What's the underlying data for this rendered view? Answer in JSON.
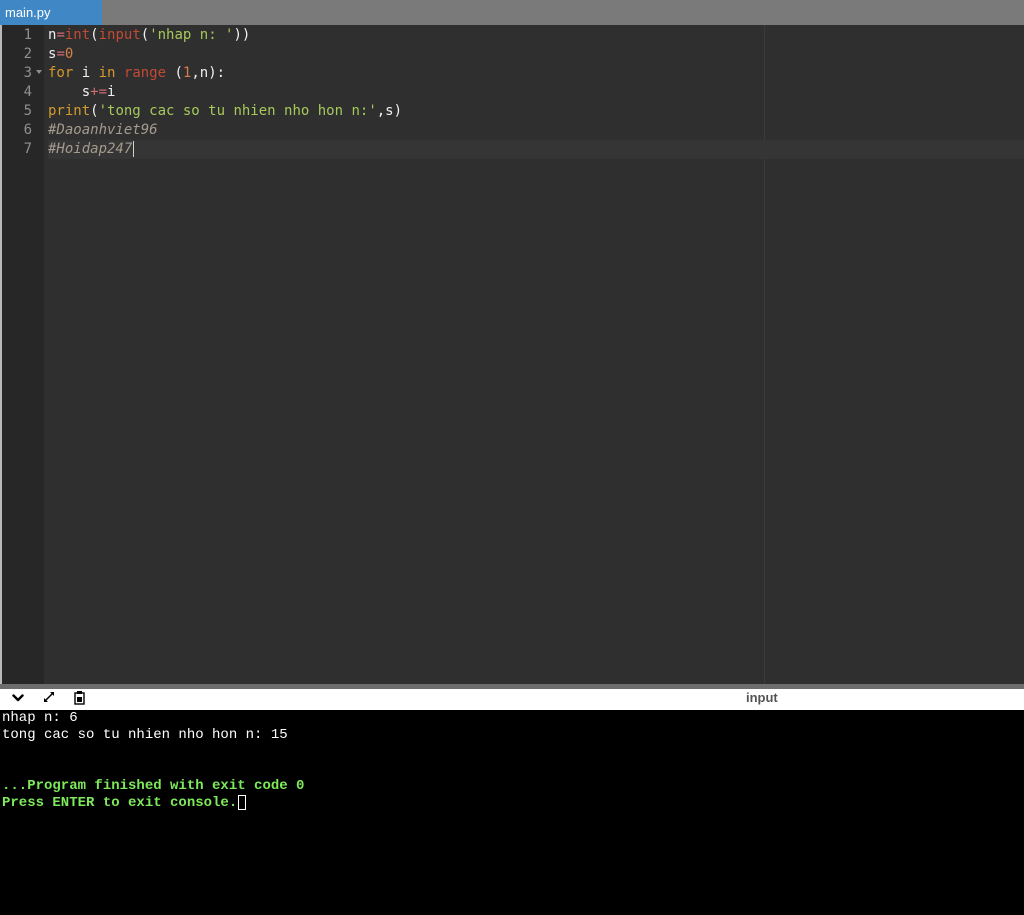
{
  "tab": {
    "label": "main.py"
  },
  "editor": {
    "line_numbers": [
      "1",
      "2",
      "3",
      "4",
      "5",
      "6",
      "7"
    ],
    "lines": [
      [
        {
          "t": "n",
          "c": "ident"
        },
        {
          "t": "=",
          "c": "op"
        },
        {
          "t": "int",
          "c": "fn"
        },
        {
          "t": "(",
          "c": "ident"
        },
        {
          "t": "input",
          "c": "fn"
        },
        {
          "t": "(",
          "c": "ident"
        },
        {
          "t": "'nhap n: '",
          "c": "str"
        },
        {
          "t": "))",
          "c": "ident"
        }
      ],
      [
        {
          "t": "s",
          "c": "ident"
        },
        {
          "t": "=",
          "c": "op"
        },
        {
          "t": "0",
          "c": "num"
        }
      ],
      [
        {
          "t": "for",
          "c": "kw"
        },
        {
          "t": " i ",
          "c": "ident"
        },
        {
          "t": "in",
          "c": "kw"
        },
        {
          "t": " ",
          "c": "ident"
        },
        {
          "t": "range",
          "c": "fn"
        },
        {
          "t": " (",
          "c": "ident"
        },
        {
          "t": "1",
          "c": "num"
        },
        {
          "t": ",n):",
          "c": "ident"
        }
      ],
      [
        {
          "t": "    s",
          "c": "ident"
        },
        {
          "t": "+=",
          "c": "op"
        },
        {
          "t": "i",
          "c": "ident"
        }
      ],
      [
        {
          "t": "print",
          "c": "kw"
        },
        {
          "t": "(",
          "c": "ident"
        },
        {
          "t": "'tong cac so tu nhien nho hon n:'",
          "c": "str"
        },
        {
          "t": ",s)",
          "c": "ident"
        }
      ],
      [
        {
          "t": "#Daoanhviet96",
          "c": "cm"
        }
      ],
      [
        {
          "t": "#Hoidap247",
          "c": "cm"
        }
      ]
    ]
  },
  "panel": {
    "collapse_icon": "chevron-down-icon",
    "expand_icon": "expand-arrows-icon",
    "copy_icon": "clipboard-icon",
    "label": "input"
  },
  "console": {
    "lines": [
      {
        "text": "nhap n: 6",
        "style": "out"
      },
      {
        "text": "tong cac so tu nhien nho hon n: 15",
        "style": "out"
      },
      {
        "text": "",
        "style": "out"
      },
      {
        "text": "",
        "style": "out"
      },
      {
        "text": "...Program finished with exit code 0",
        "style": "ok"
      },
      {
        "text": "Press ENTER to exit console.",
        "style": "ok"
      }
    ]
  }
}
